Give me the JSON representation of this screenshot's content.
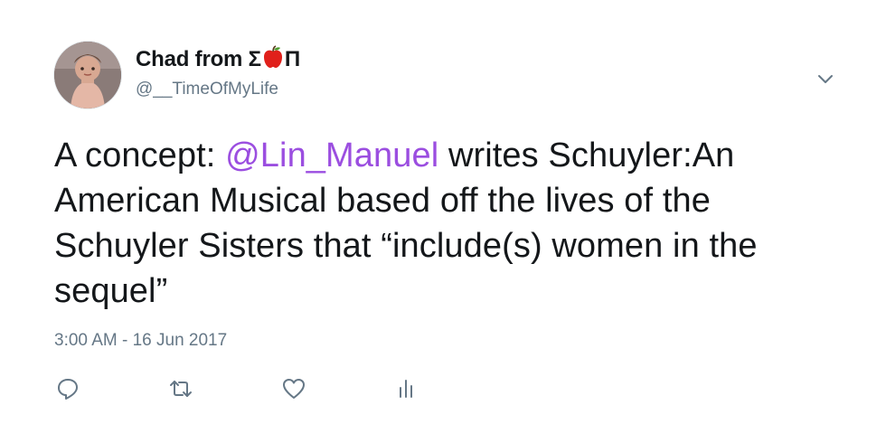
{
  "user": {
    "name_prefix": "Chad from Σ",
    "name_suffix": "Π",
    "handle": "@__TimeOfMyLife"
  },
  "tweet": {
    "text_before": "A concept: ",
    "mention": "@Lin_Manuel",
    "text_after": " writes Schuyler:An American Musical based off the lives of the Schuyler Sisters that “include(s) women in the sequel”",
    "timestamp": "3:00 AM - 16 Jun 2017"
  },
  "actions": [
    {
      "icon": "reply-icon"
    },
    {
      "icon": "retweet-icon"
    },
    {
      "icon": "like-icon"
    },
    {
      "icon": "analytics-icon"
    }
  ],
  "colors": {
    "mention": "#9b4ee0",
    "text": "#14171a",
    "secondary": "#657786",
    "apple": "#e0201b"
  }
}
